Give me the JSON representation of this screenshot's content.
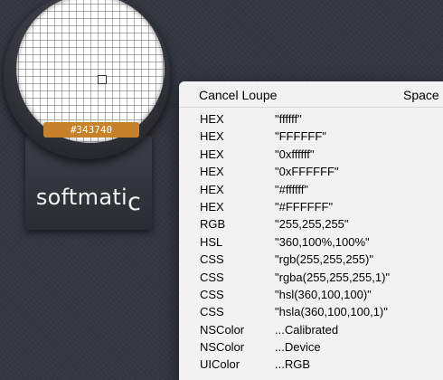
{
  "loupe": {
    "hex_value": "#343740",
    "brand_text": "softmati",
    "brand_suffix": "c"
  },
  "menu": {
    "cancel_label": "Cancel Loupe",
    "cancel_shortcut": "Space",
    "items": [
      {
        "format": "HEX",
        "value": "\"ffffff\""
      },
      {
        "format": "HEX",
        "value": "\"FFFFFF\""
      },
      {
        "format": "HEX",
        "value": "\"0xffffff\""
      },
      {
        "format": "HEX",
        "value": "\"0xFFFFFF\""
      },
      {
        "format": "HEX",
        "value": "\"#ffffff\""
      },
      {
        "format": "HEX",
        "value": "\"#FFFFFF\""
      },
      {
        "format": "RGB",
        "value": "\"255,255,255\""
      },
      {
        "format": "HSL",
        "value": "\"360,100%,100%\""
      },
      {
        "format": "CSS",
        "value": "\"rgb(255,255,255)\""
      },
      {
        "format": "CSS",
        "value": "\"rgba(255,255,255,1)\""
      },
      {
        "format": "CSS",
        "value": "\"hsl(360,100,100)\""
      },
      {
        "format": "CSS",
        "value": "\"hsla(360,100,100,1)\""
      },
      {
        "format": "NSColor",
        "value": "...Calibrated"
      },
      {
        "format": "NSColor",
        "value": "...Device"
      },
      {
        "format": "UIColor",
        "value": "...RGB"
      }
    ]
  },
  "colors": {
    "background": "#343740",
    "badge": "#c8812b",
    "sampled": "#ffffff"
  }
}
